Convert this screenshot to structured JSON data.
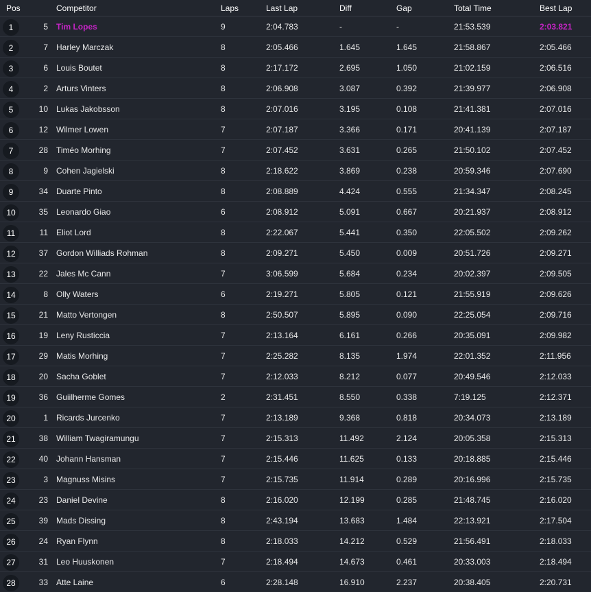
{
  "headers": {
    "pos": "Pos",
    "competitor": "Competitor",
    "laps": "Laps",
    "last_lap": "Last Lap",
    "diff": "Diff",
    "gap": "Gap",
    "total_time": "Total Time",
    "best_lap": "Best Lap"
  },
  "colors": {
    "background": "#22262e",
    "highlight": "#c424c4",
    "badge": "#161a20"
  },
  "rows": [
    {
      "pos": "1",
      "num": "5",
      "name": "Tim Lopes",
      "laps": "9",
      "last_lap": "2:04.783",
      "diff": "-",
      "gap": "-",
      "total_time": "21:53.539",
      "best_lap": "2:03.821",
      "highlight": true
    },
    {
      "pos": "2",
      "num": "7",
      "name": "Harley Marczak",
      "laps": "8",
      "last_lap": "2:05.466",
      "diff": "1.645",
      "gap": "1.645",
      "total_time": "21:58.867",
      "best_lap": "2:05.466"
    },
    {
      "pos": "3",
      "num": "6",
      "name": "Louis Boutet",
      "laps": "8",
      "last_lap": "2:17.172",
      "diff": "2.695",
      "gap": "1.050",
      "total_time": "21:02.159",
      "best_lap": "2:06.516"
    },
    {
      "pos": "4",
      "num": "2",
      "name": "Arturs Vinters",
      "laps": "8",
      "last_lap": "2:06.908",
      "diff": "3.087",
      "gap": "0.392",
      "total_time": "21:39.977",
      "best_lap": "2:06.908"
    },
    {
      "pos": "5",
      "num": "10",
      "name": "Lukas Jakobsson",
      "laps": "8",
      "last_lap": "2:07.016",
      "diff": "3.195",
      "gap": "0.108",
      "total_time": "21:41.381",
      "best_lap": "2:07.016"
    },
    {
      "pos": "6",
      "num": "12",
      "name": "Wilmer Lowen",
      "laps": "7",
      "last_lap": "2:07.187",
      "diff": "3.366",
      "gap": "0.171",
      "total_time": "20:41.139",
      "best_lap": "2:07.187"
    },
    {
      "pos": "7",
      "num": "28",
      "name": "Timéo Morhing",
      "laps": "7",
      "last_lap": "2:07.452",
      "diff": "3.631",
      "gap": "0.265",
      "total_time": "21:50.102",
      "best_lap": "2:07.452"
    },
    {
      "pos": "8",
      "num": "9",
      "name": "Cohen Jagielski",
      "laps": "8",
      "last_lap": "2:18.622",
      "diff": "3.869",
      "gap": "0.238",
      "total_time": "20:59.346",
      "best_lap": "2:07.690"
    },
    {
      "pos": "9",
      "num": "34",
      "name": "Duarte Pinto",
      "laps": "8",
      "last_lap": "2:08.889",
      "diff": "4.424",
      "gap": "0.555",
      "total_time": "21:34.347",
      "best_lap": "2:08.245"
    },
    {
      "pos": "10",
      "num": "35",
      "name": "Leonardo Giao",
      "laps": "6",
      "last_lap": "2:08.912",
      "diff": "5.091",
      "gap": "0.667",
      "total_time": "20:21.937",
      "best_lap": "2:08.912"
    },
    {
      "pos": "11",
      "num": "11",
      "name": "Eliot Lord",
      "laps": "8",
      "last_lap": "2:22.067",
      "diff": "5.441",
      "gap": "0.350",
      "total_time": "22:05.502",
      "best_lap": "2:09.262"
    },
    {
      "pos": "12",
      "num": "37",
      "name": "Gordon Williads Rohman",
      "laps": "8",
      "last_lap": "2:09.271",
      "diff": "5.450",
      "gap": "0.009",
      "total_time": "20:51.726",
      "best_lap": "2:09.271"
    },
    {
      "pos": "13",
      "num": "22",
      "name": "Jales Mc Cann",
      "laps": "7",
      "last_lap": "3:06.599",
      "diff": "5.684",
      "gap": "0.234",
      "total_time": "20:02.397",
      "best_lap": "2:09.505"
    },
    {
      "pos": "14",
      "num": "8",
      "name": "Olly Waters",
      "laps": "6",
      "last_lap": "2:19.271",
      "diff": "5.805",
      "gap": "0.121",
      "total_time": "21:55.919",
      "best_lap": "2:09.626"
    },
    {
      "pos": "15",
      "num": "21",
      "name": "Matto Vertongen",
      "laps": "8",
      "last_lap": "2:50.507",
      "diff": "5.895",
      "gap": "0.090",
      "total_time": "22:25.054",
      "best_lap": "2:09.716"
    },
    {
      "pos": "16",
      "num": "19",
      "name": "Leny Rusticcia",
      "laps": "7",
      "last_lap": "2:13.164",
      "diff": "6.161",
      "gap": "0.266",
      "total_time": "20:35.091",
      "best_lap": "2:09.982"
    },
    {
      "pos": "17",
      "num": "29",
      "name": "Matis Morhing",
      "laps": "7",
      "last_lap": "2:25.282",
      "diff": "8.135",
      "gap": "1.974",
      "total_time": "22:01.352",
      "best_lap": "2:11.956"
    },
    {
      "pos": "18",
      "num": "20",
      "name": "Sacha Goblet",
      "laps": "7",
      "last_lap": "2:12.033",
      "diff": "8.212",
      "gap": "0.077",
      "total_time": "20:49.546",
      "best_lap": "2:12.033"
    },
    {
      "pos": "19",
      "num": "36",
      "name": "Guiilherme Gomes",
      "laps": "2",
      "last_lap": "2:31.451",
      "diff": "8.550",
      "gap": "0.338",
      "total_time": "7:19.125",
      "best_lap": "2:12.371"
    },
    {
      "pos": "20",
      "num": "1",
      "name": "Ricards Jurcenko",
      "laps": "7",
      "last_lap": "2:13.189",
      "diff": "9.368",
      "gap": "0.818",
      "total_time": "20:34.073",
      "best_lap": "2:13.189"
    },
    {
      "pos": "21",
      "num": "38",
      "name": "William Twagiramungu",
      "laps": "7",
      "last_lap": "2:15.313",
      "diff": "11.492",
      "gap": "2.124",
      "total_time": "20:05.358",
      "best_lap": "2:15.313"
    },
    {
      "pos": "22",
      "num": "40",
      "name": "Johann Hansman",
      "laps": "7",
      "last_lap": "2:15.446",
      "diff": "11.625",
      "gap": "0.133",
      "total_time": "20:18.885",
      "best_lap": "2:15.446"
    },
    {
      "pos": "23",
      "num": "3",
      "name": "Magnuss Misins",
      "laps": "7",
      "last_lap": "2:15.735",
      "diff": "11.914",
      "gap": "0.289",
      "total_time": "20:16.996",
      "best_lap": "2:15.735"
    },
    {
      "pos": "24",
      "num": "23",
      "name": "Daniel Devine",
      "laps": "8",
      "last_lap": "2:16.020",
      "diff": "12.199",
      "gap": "0.285",
      "total_time": "21:48.745",
      "best_lap": "2:16.020"
    },
    {
      "pos": "25",
      "num": "39",
      "name": "Mads Dissing",
      "laps": "8",
      "last_lap": "2:43.194",
      "diff": "13.683",
      "gap": "1.484",
      "total_time": "22:13.921",
      "best_lap": "2:17.504"
    },
    {
      "pos": "26",
      "num": "24",
      "name": "Ryan Flynn",
      "laps": "8",
      "last_lap": "2:18.033",
      "diff": "14.212",
      "gap": "0.529",
      "total_time": "21:56.491",
      "best_lap": "2:18.033"
    },
    {
      "pos": "27",
      "num": "31",
      "name": "Leo Huuskonen",
      "laps": "7",
      "last_lap": "2:18.494",
      "diff": "14.673",
      "gap": "0.461",
      "total_time": "20:33.003",
      "best_lap": "2:18.494"
    },
    {
      "pos": "28",
      "num": "33",
      "name": "Atte Laine",
      "laps": "6",
      "last_lap": "2:28.148",
      "diff": "16.910",
      "gap": "2.237",
      "total_time": "20:38.405",
      "best_lap": "2:20.731"
    }
  ]
}
